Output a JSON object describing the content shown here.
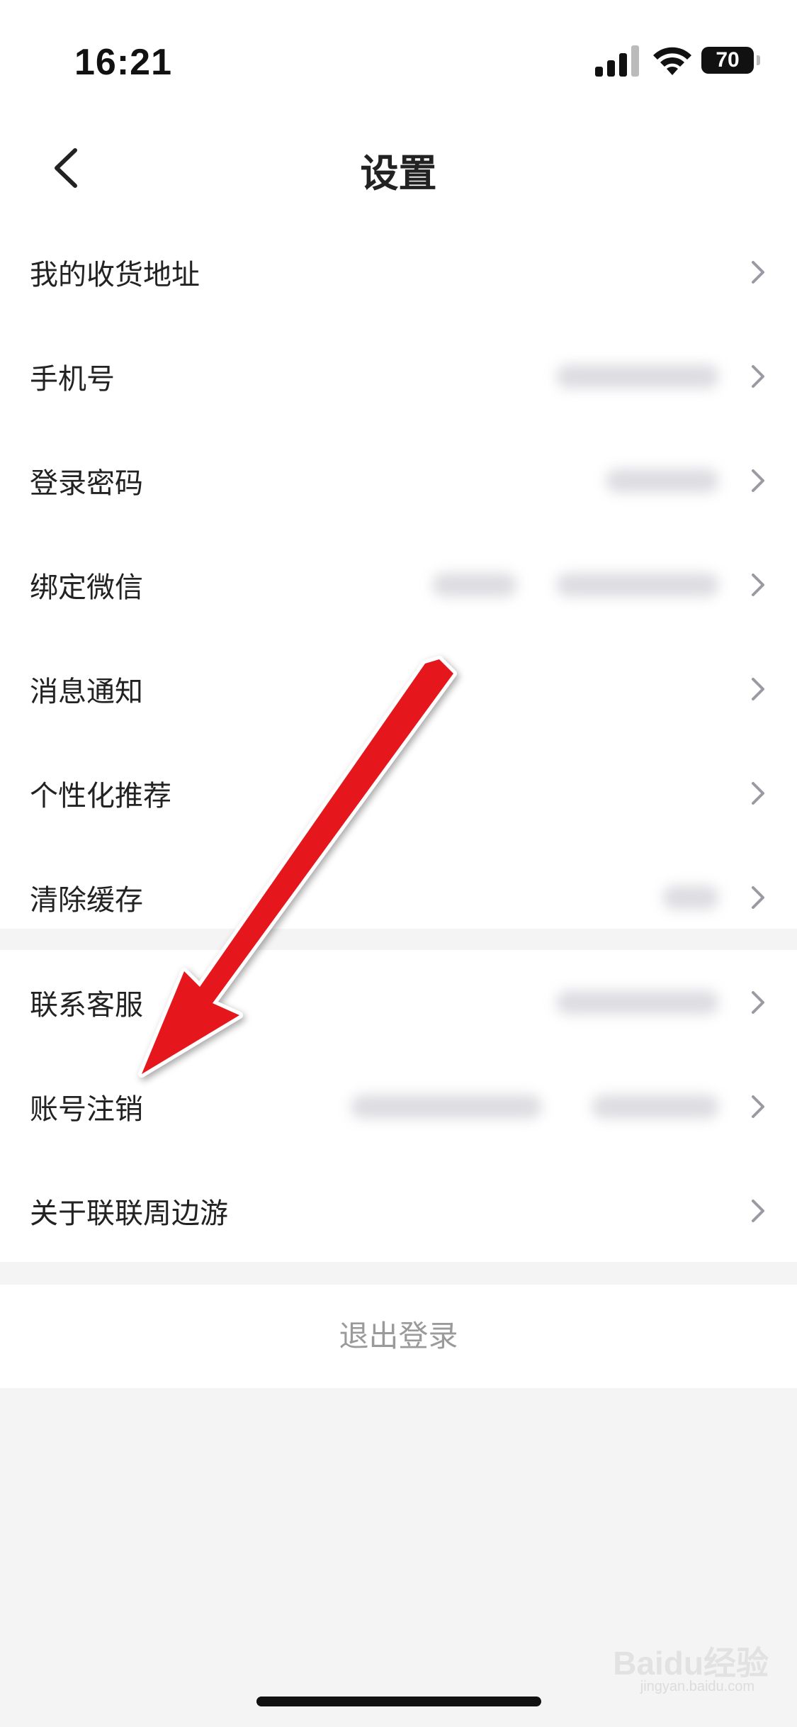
{
  "status_bar": {
    "time": "16:21",
    "battery": "70"
  },
  "nav": {
    "title": "设置"
  },
  "settings_group_1": [
    {
      "label": "我的收货地址"
    },
    {
      "label": "手机号"
    },
    {
      "label": "登录密码"
    },
    {
      "label": "绑定微信"
    },
    {
      "label": "消息通知"
    },
    {
      "label": "个性化推荐"
    },
    {
      "label": "清除缓存"
    }
  ],
  "settings_group_2": [
    {
      "label": "联系客服"
    },
    {
      "label": "账号注销"
    },
    {
      "label": "关于联联周边游"
    }
  ],
  "logout": {
    "label": "退出登录"
  },
  "annotation": {
    "color": "#e5171d"
  },
  "watermark": {
    "text": "Baidu经验",
    "sub": "jingyan.baidu.com"
  }
}
